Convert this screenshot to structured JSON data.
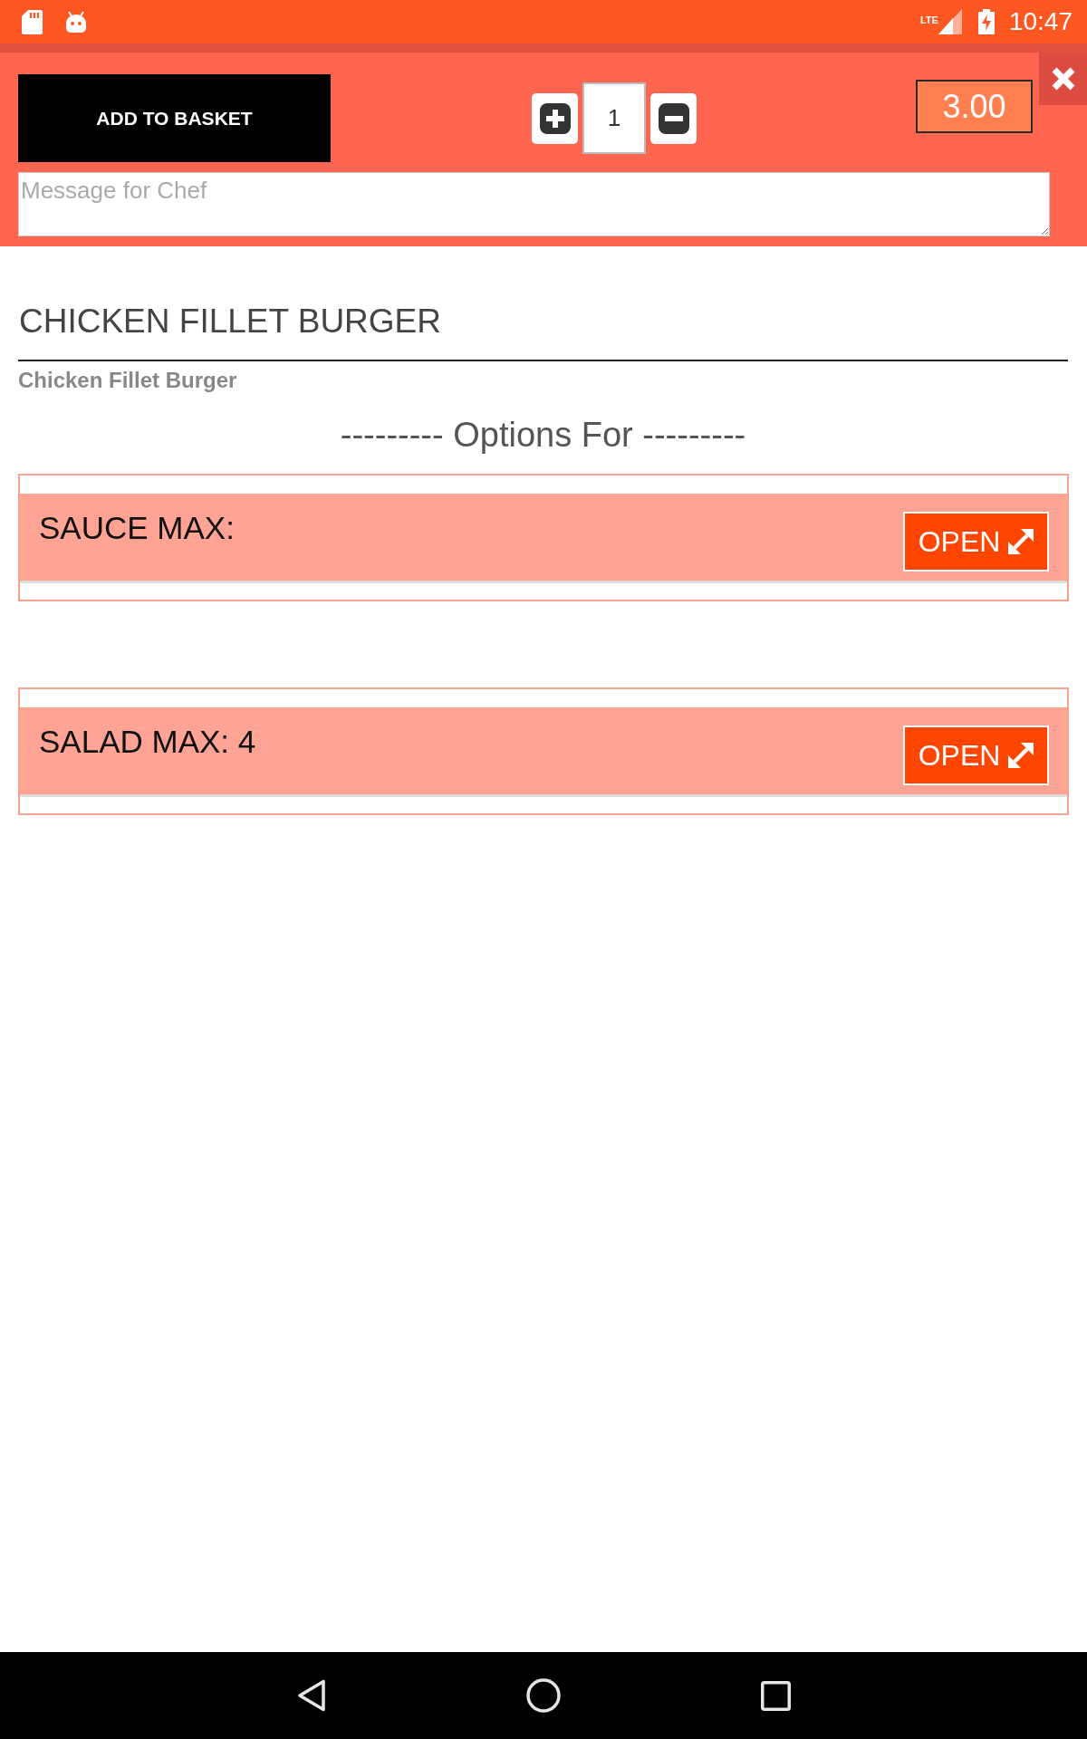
{
  "status_bar": {
    "network": "LTE",
    "time": "10:47"
  },
  "order_panel": {
    "add_button": "ADD TO BASKET",
    "quantity": "1",
    "price": "3.00",
    "message": {
      "placeholder": "Message for Chef"
    }
  },
  "product": {
    "title": "CHICKEN FILLET BURGER",
    "description": "Chicken Fillet Burger"
  },
  "options_heading": "--------- Options For ---------",
  "option_groups": [
    {
      "label": "SAUCE MAX:",
      "button": "OPEN"
    },
    {
      "label": "SALAD MAX: 4",
      "button": "OPEN"
    }
  ]
}
